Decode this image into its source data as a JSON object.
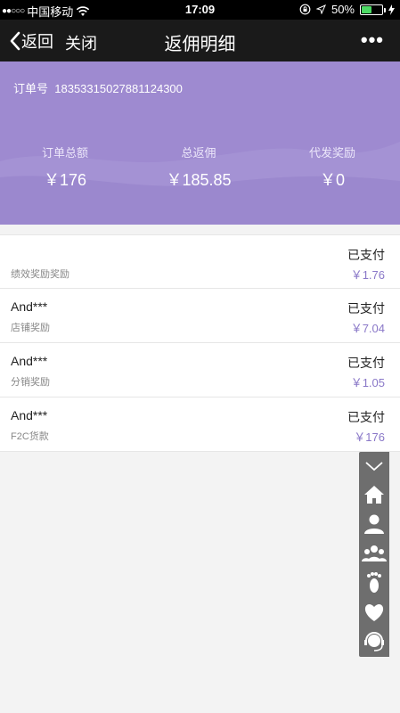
{
  "status_bar": {
    "carrier": "中国移动",
    "time": "17:09",
    "battery": "50%",
    "battery_level": 0.5
  },
  "nav": {
    "back_label": "返回",
    "close_label": "关闭",
    "title": "返佣明细",
    "more_label": "•••"
  },
  "summary": {
    "order_label": "订单号",
    "order_number": "18353315027881124300",
    "stats": [
      {
        "label": "订单总额",
        "value": "￥176"
      },
      {
        "label": "总返佣",
        "value": "￥185.85"
      },
      {
        "label": "代发奖励",
        "value": "￥0"
      }
    ]
  },
  "records": [
    {
      "user": "",
      "type": "绩效奖励奖励",
      "status": "已支付",
      "amount": "￥1.76"
    },
    {
      "user": "And***",
      "type": "店铺奖励",
      "status": "已支付",
      "amount": "￥7.04"
    },
    {
      "user": "And***",
      "type": "分销奖励",
      "status": "已支付",
      "amount": "￥1.05"
    },
    {
      "user": "And***",
      "type": "F2C货款",
      "status": "已支付",
      "amount": "￥176"
    }
  ],
  "float_menu": [
    "collapse-icon",
    "home-icon",
    "user-icon",
    "group-icon",
    "footprint-icon",
    "heart-icon",
    "support-icon"
  ],
  "colors": {
    "header_purple": "#9e8ad0",
    "amount_purple": "#8a78c8",
    "navbar": "#1a1a1a"
  }
}
